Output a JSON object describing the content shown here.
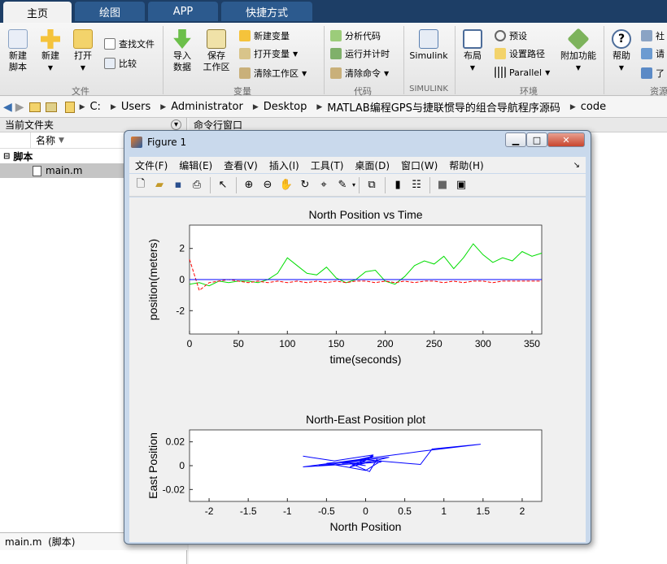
{
  "tabs": [
    {
      "label": "主页"
    },
    {
      "label": "绘图"
    },
    {
      "label": "APP"
    },
    {
      "label": "快捷方式"
    }
  ],
  "ribbon": {
    "new_script": "新建\n脚本",
    "new": "新建",
    "open": "打开",
    "find_files": "查找文件",
    "compare": "比较",
    "import": "导入\n数据",
    "save_ws": "保存\n工作区",
    "new_var": "新建变量",
    "open_var": "打开变量",
    "clear_ws": "清除工作区",
    "analyze": "分析代码",
    "run_time": "运行并计时",
    "clear_cmd": "清除命令",
    "simulink": "Simulink",
    "layout": "布局",
    "prefs": "预设",
    "set_path": "设置路径",
    "parallel": "Parallel",
    "addons": "附加功能",
    "help": "帮助",
    "community": "社",
    "request": "请",
    "learn": "了",
    "group_file": "文件",
    "group_var": "变量",
    "group_code": "代码",
    "group_simulink": "SIMULINK",
    "group_env": "环境",
    "group_res": "资源"
  },
  "address": {
    "crumbs": [
      "C:",
      "Users",
      "Administrator",
      "Desktop",
      "MATLAB编程GPS与捷联惯导的组合导航程序源码",
      "code"
    ]
  },
  "left_panel": {
    "title": "当前文件夹",
    "col_name": "名称",
    "group": "脚本",
    "file": "main.m",
    "status": "main.m  (脚本)"
  },
  "right_panel": {
    "title": "命令行窗口"
  },
  "figure": {
    "title": "Figure 1",
    "menus": [
      "文件(F)",
      "编辑(E)",
      "查看(V)",
      "插入(I)",
      "工具(T)",
      "桌面(D)",
      "窗口(W)",
      "帮助(H)"
    ]
  },
  "colors": {
    "tabbar": "#1d3e66",
    "series_green": "#00dd00",
    "series_red": "#ff0000",
    "series_blue": "#0000ff"
  },
  "chart_data": [
    {
      "type": "line",
      "title": "North Position vs Time",
      "xlabel": "time(seconds)",
      "ylabel": "position(meters)",
      "xlim": [
        0,
        360
      ],
      "ylim": [
        -3.5,
        3.5
      ],
      "xticks": [
        0,
        50,
        100,
        150,
        200,
        250,
        300,
        350
      ],
      "yticks": [
        2,
        0,
        -2
      ],
      "x": [
        0,
        10,
        20,
        30,
        40,
        50,
        60,
        70,
        80,
        90,
        100,
        110,
        120,
        130,
        140,
        150,
        160,
        170,
        180,
        190,
        200,
        210,
        220,
        230,
        240,
        250,
        260,
        270,
        280,
        290,
        300,
        310,
        320,
        330,
        340,
        350,
        360
      ],
      "series": [
        {
          "color": "green",
          "values": [
            -0.3,
            -0.2,
            -0.4,
            -0.1,
            -0.2,
            -0.1,
            -0.1,
            -0.2,
            0,
            0.4,
            1.4,
            0.9,
            0.4,
            0.3,
            0.8,
            0.1,
            -0.2,
            0,
            0.5,
            0.6,
            -0.1,
            -0.3,
            0.2,
            0.9,
            1.2,
            1.0,
            1.5,
            0.7,
            1.4,
            2.3,
            1.6,
            1.1,
            1.4,
            1.2,
            1.8,
            1.5,
            1.7
          ]
        },
        {
          "color": "red",
          "values": [
            1.3,
            -0.7,
            -0.2,
            -0.1,
            0,
            -0.1,
            -0.2,
            -0.1,
            -0.2,
            -0.1,
            -0.2,
            -0.1,
            -0.2,
            -0.1,
            -0.2,
            -0.1,
            -0.2,
            -0.1,
            -0.1,
            -0.2,
            -0.1,
            -0.2,
            -0.1,
            -0.2,
            -0.1,
            -0.1,
            -0.2,
            -0.1,
            -0.2,
            -0.1,
            -0.1,
            -0.2,
            -0.1,
            -0.1,
            -0.1,
            -0.1,
            -0.1
          ]
        },
        {
          "color": "blue",
          "values": [
            0,
            0,
            0,
            0,
            0,
            0,
            0,
            0,
            0,
            0,
            0,
            0,
            0,
            0,
            0,
            0,
            0,
            0,
            0,
            0,
            0,
            0,
            0,
            0,
            0,
            0,
            0,
            0,
            0,
            0,
            0,
            0,
            0,
            0,
            0,
            0,
            0
          ]
        }
      ]
    },
    {
      "type": "line",
      "title": "North-East Position plot",
      "xlabel": "North Position",
      "ylabel": "East Position",
      "xlim": [
        -2.25,
        2.25
      ],
      "ylim": [
        -0.03,
        0.03
      ],
      "xticks": [
        -2,
        -1.5,
        -1,
        -0.5,
        0,
        0.5,
        1,
        1.5,
        2
      ],
      "yticks": [
        0.02,
        0,
        -0.02
      ],
      "series": [
        {
          "color": "blue",
          "x": [
            -0.8,
            -0.4,
            0.1,
            -0.2,
            0.3,
            -0.5,
            0.0,
            0.2,
            -0.3,
            0.1,
            -0.1,
            0.0,
            0.7,
            0.85,
            1.47,
            0.7,
            -0.8,
            0.2,
            -0.6,
            0.15,
            0.05,
            -0.2,
            0.0
          ],
          "y": [
            0.008,
            0.004,
            0.009,
            -0.001,
            0.007,
            0.002,
            -0.004,
            0.004,
            0.002,
            0.008,
            0.001,
            0.005,
            0.001,
            0.014,
            0.018,
            0.012,
            -0.001,
            0.003,
            0.0,
            0.006,
            -0.005,
            0.002,
            0.0
          ]
        }
      ]
    }
  ]
}
